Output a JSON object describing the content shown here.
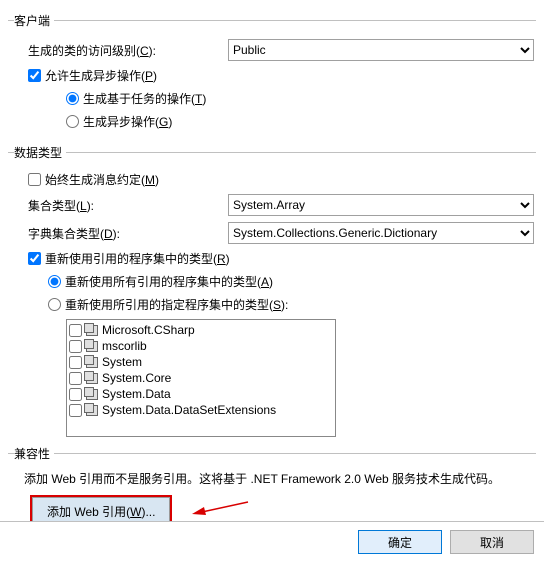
{
  "client": {
    "legend": "客户端",
    "access_label": "生成的类的访问级别(",
    "access_key": "C",
    "access_suffix": "):",
    "access_value": "Public",
    "async_label": "允许生成异步操作(",
    "async_key": "P",
    "async_suffix": ")",
    "async_checked": true,
    "task_label": "生成基于任务的操作(",
    "task_key": "T",
    "task_suffix": ")",
    "task_selected": true,
    "async_op_label": "生成异步操作(",
    "async_op_key": "G",
    "async_op_suffix": ")"
  },
  "data": {
    "legend": "数据类型",
    "msgc_label": "始终生成消息约定(",
    "msgc_key": "M",
    "msgc_suffix": ")",
    "msgc_checked": false,
    "coll_label": "集合类型(",
    "coll_key": "L",
    "coll_suffix": "):",
    "coll_value": "System.Array",
    "dict_label": "字典集合类型(",
    "dict_key": "D",
    "dict_suffix": "):",
    "dict_value": "System.Collections.Generic.Dictionary",
    "reuse_label": "重新使用引用的程序集中的类型(",
    "reuse_key": "R",
    "reuse_suffix": ")",
    "reuse_checked": true,
    "reuse_all_label": "重新使用所有引用的程序集中的类型(",
    "reuse_all_key": "A",
    "reuse_all_suffix": ")",
    "reuse_all_selected": true,
    "reuse_spec_label": "重新使用所引用的指定程序集中的类型(",
    "reuse_spec_key": "S",
    "reuse_spec_suffix": "):",
    "assemblies": [
      "Microsoft.CSharp",
      "mscorlib",
      "System",
      "System.Core",
      "System.Data",
      "System.Data.DataSetExtensions"
    ]
  },
  "compat": {
    "legend": "兼容性",
    "text": "添加 Web 引用而不是服务引用。这将基于 .NET Framework 2.0 Web 服务技术生成代码。",
    "webref_label": "添加 Web 引用(",
    "webref_key": "W",
    "webref_suffix": ")..."
  },
  "footer": {
    "ok": "确定",
    "cancel": "取消"
  }
}
